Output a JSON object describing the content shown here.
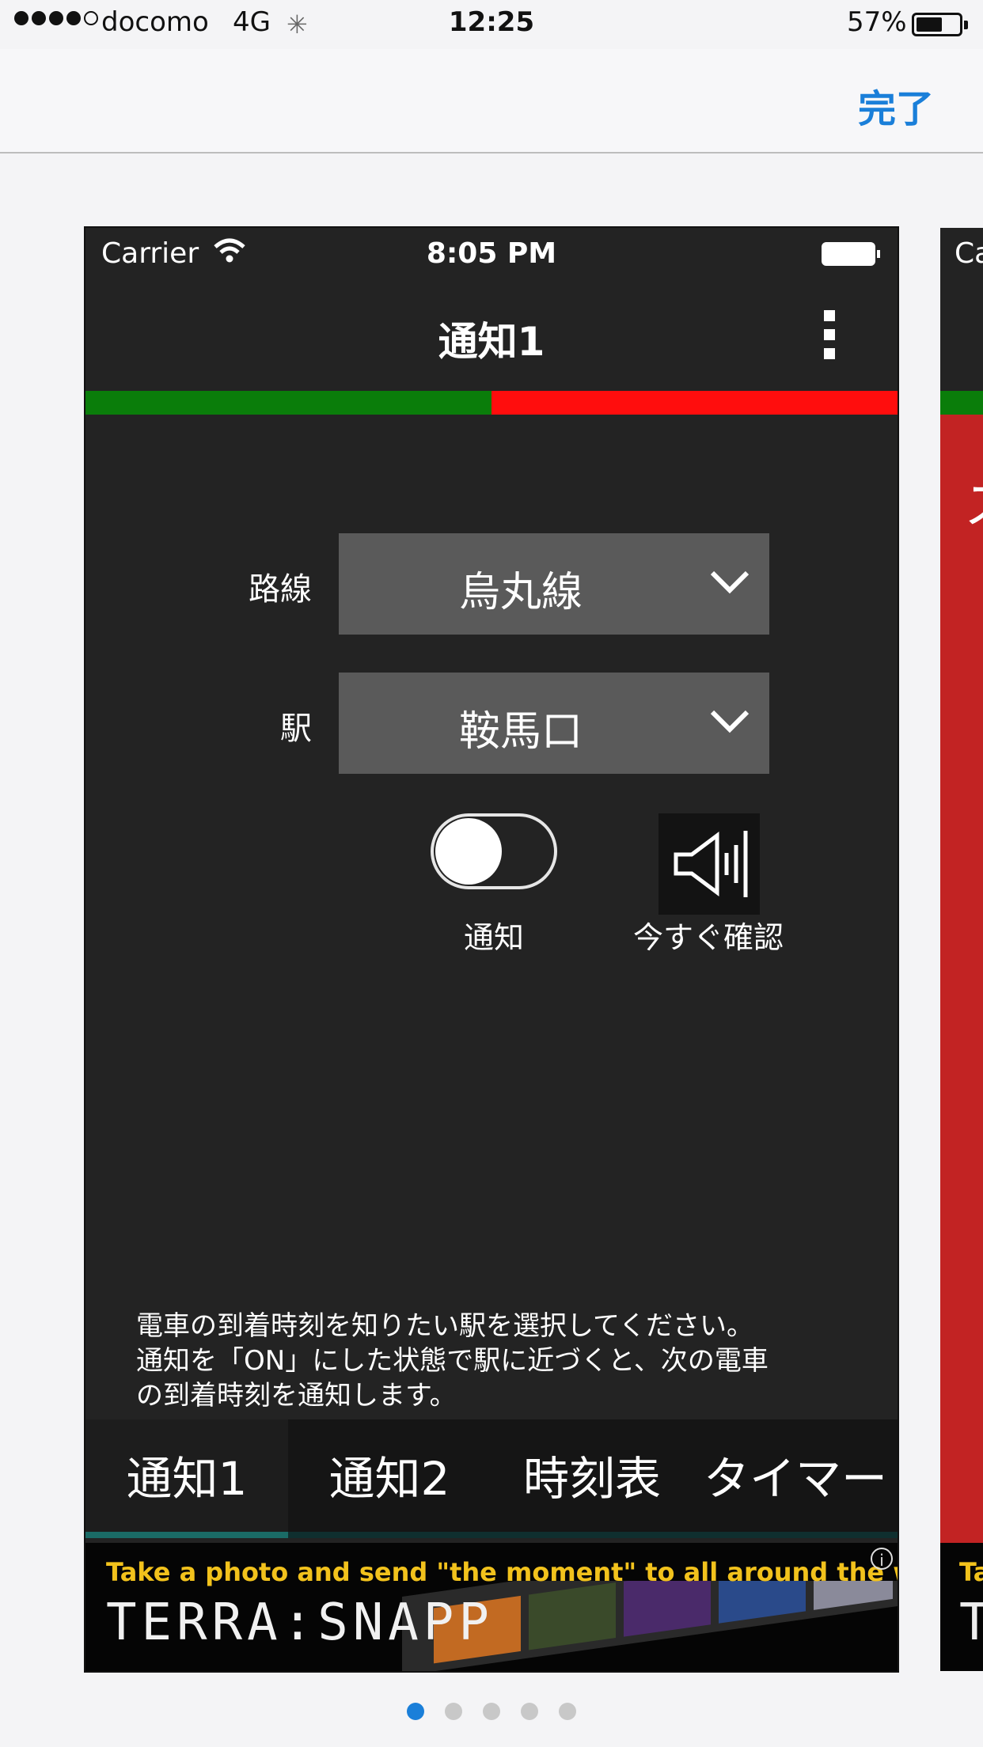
{
  "ios_status": {
    "carrier": "docomo",
    "network": "4G",
    "time": "12:25",
    "battery": "57%"
  },
  "nav": {
    "done_label": "完了",
    "accent_color": "#1a7fd9"
  },
  "screen": {
    "status": {
      "carrier": "Carrier",
      "time": "8:05 PM"
    },
    "title": "通知1",
    "progress_green_fraction": 0.5,
    "line_label": "路線",
    "line_value": "烏丸線",
    "station_label": "駅",
    "station_value": "鞍馬口",
    "notify_label": "通知",
    "check_now_label": "今すぐ確認",
    "description_lines": [
      "電車の到着時刻を知りたい駅を選択してください。",
      "通知を「ON」にした状態で駅に近づくと、次の電車",
      "の到着時刻を通知します。"
    ],
    "tabs": [
      "通知1",
      "通知2",
      "時刻表",
      "タイマー"
    ],
    "ad": {
      "tagline": "Take a photo and send  \"the moment\" to all around the world!",
      "brand": "TERRA:SNAPP"
    }
  },
  "next_card": {
    "carrier": "Ca",
    "glyph": "ス",
    "ad_t": "Ta",
    "ad_brand": "T"
  },
  "pager": {
    "count": 5,
    "active": 0
  }
}
